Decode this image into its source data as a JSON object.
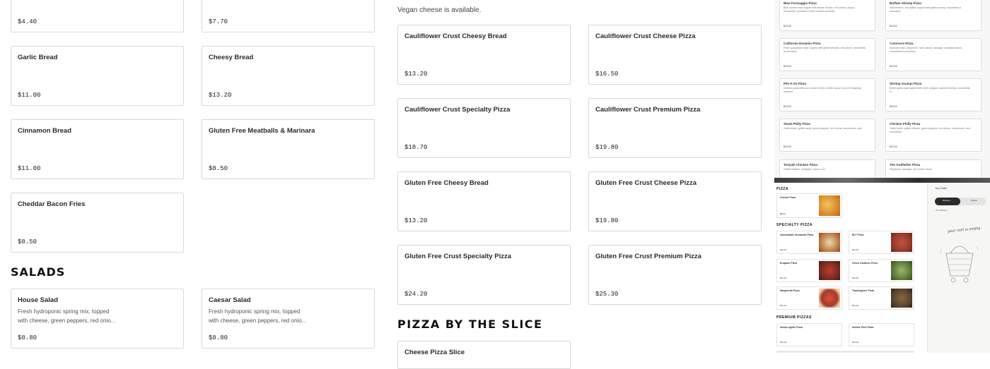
{
  "left_column": [
    {
      "name": "",
      "price": "$4.40"
    },
    {
      "name": "Garlic Bread",
      "price": "$11.00"
    },
    {
      "name": "Cinnamon Bread",
      "price": "$11.00"
    },
    {
      "name": "Cheddar Bacon Fries",
      "price": "$8.50"
    }
  ],
  "middle_column": [
    {
      "name": "",
      "price": "$7.70"
    },
    {
      "name": "Cheesy Bread",
      "price": "$13.20"
    },
    {
      "name": "Gluten Free Meatballs & Marinara",
      "price": "$8.50"
    }
  ],
  "salads": {
    "heading": "SALADS",
    "items": [
      {
        "name": "House Salad",
        "desc": "Fresh hydroponic spring mix, topped with cheese, green peppers, red onio...",
        "price": "$8.80"
      },
      {
        "name": "Caesar Salad",
        "desc": "Fresh hydroponic spring mix, topped with cheese, green peppers, red onio...",
        "price": "$8.80"
      }
    ]
  },
  "specialty": {
    "note": "Vegan cheese is available.",
    "items": [
      {
        "name": "Cauliflower Crust Cheesy Bread",
        "price": "$13.20"
      },
      {
        "name": "Cauliflower Crust Cheese Pizza",
        "price": "$16.50"
      },
      {
        "name": "Cauliflower Crust Specialty Pizza",
        "price": "$18.70"
      },
      {
        "name": "Cauliflower Crust Premium Pizza",
        "price": "$19.80"
      },
      {
        "name": "Gluten Free Cheesy Bread",
        "price": "$13.20"
      },
      {
        "name": "Gluten Free Crust Cheese Pizza",
        "price": "$19.80"
      },
      {
        "name": "Gluten Free Crust Specialty Pizza",
        "price": "$24.20"
      },
      {
        "name": "Gluten Free Crust Premium Pizza",
        "price": "$25.30"
      }
    ]
  },
  "slice": {
    "heading": "PIZZA BY THE SLICE",
    "first_item": "Cheese Pizza Slice"
  },
  "thumb_top": [
    {
      "name": "Blue Formaggio Pizza",
      "desc": "Blue cheese base topped with tender chicken, red onions, bacon, mozzarella, provolone & blue cheese crumbles.",
      "price": "$13.20"
    },
    {
      "name": "Buffalo Shrimp Pizza",
      "desc": "Mild medium, hot buffalo topped with grilled shrimp, mozzarella & provolone.",
      "price": "$13.20"
    },
    {
      "name": "California Dreamin Pizza",
      "desc": "Fresh guacamole base, topped with grilled chicken, red onions, mozzarella & provolone.",
      "price": "$13.20"
    },
    {
      "name": "Carnivore Pizza",
      "desc": "Marinara base, pepperoni, ham, bacon, sausage, canadian bacon, mozzarella & provolone.",
      "price": "$13.20"
    },
    {
      "name": "Pile It On Pizza",
      "desc": "Cheese pizza with your choice of red or white sauce & up to 5 toppings included.",
      "price": "$13.20"
    },
    {
      "name": "Shrimp Scampi Pizza",
      "desc": "Butter garlic base topped with fresh oregano, sauteed shrimp, mozzarella &...",
      "price": "$13.20"
    },
    {
      "name": "Steak Philly Pizza",
      "desc": "Garlic butter, grilled steak, green peppers, red onions, mushrooms, and...",
      "price": "$13.20"
    },
    {
      "name": "Chicken Philly Pizza",
      "desc": "Garlic butter, grilled chicken, green peppers, red onions, mushrooms, and mozzarella.",
      "price": "$13.20"
    },
    {
      "name": "Teriyaki Chicken Pizza",
      "desc": "Grilled chicken, pineapple, bacon, red",
      "price": ""
    },
    {
      "name": "The Godfather Pizza",
      "desc": "Pepperoni, sausage, red onions, black",
      "price": ""
    }
  ],
  "thumb_bottom": {
    "pizza_heading": "PIZZA",
    "specialty_heading": "SPECIALTY PIZZA",
    "premium_heading": "PREMIUM PIZZAS",
    "items": [
      {
        "name": "Cheese Pizza",
        "price": "$8.80"
      },
      {
        "name": "Abominable Snowman Pizza",
        "price": "$11.00"
      },
      {
        "name": "BLT Pizza",
        "price": "$11.00"
      },
      {
        "name": "Eruption Pizza",
        "price": "$11.00"
      },
      {
        "name": "Green Goddess Pizza",
        "price": "$11.00"
      },
      {
        "name": "Margherita Pizza",
        "price": "$11.00"
      },
      {
        "name": "Thanksgiven Pizza",
        "price": "$11.00"
      },
      {
        "name": "Aloha Lignite Pizza",
        "price": "$13.20"
      },
      {
        "name": "Atomic Pork Pizza",
        "price": "$13.20"
      }
    ],
    "order": {
      "title": "Your Order",
      "delivery": "Delivery",
      "pickup": "Pickup",
      "no_address": "No address",
      "cart_text": "your cart is empty"
    }
  }
}
